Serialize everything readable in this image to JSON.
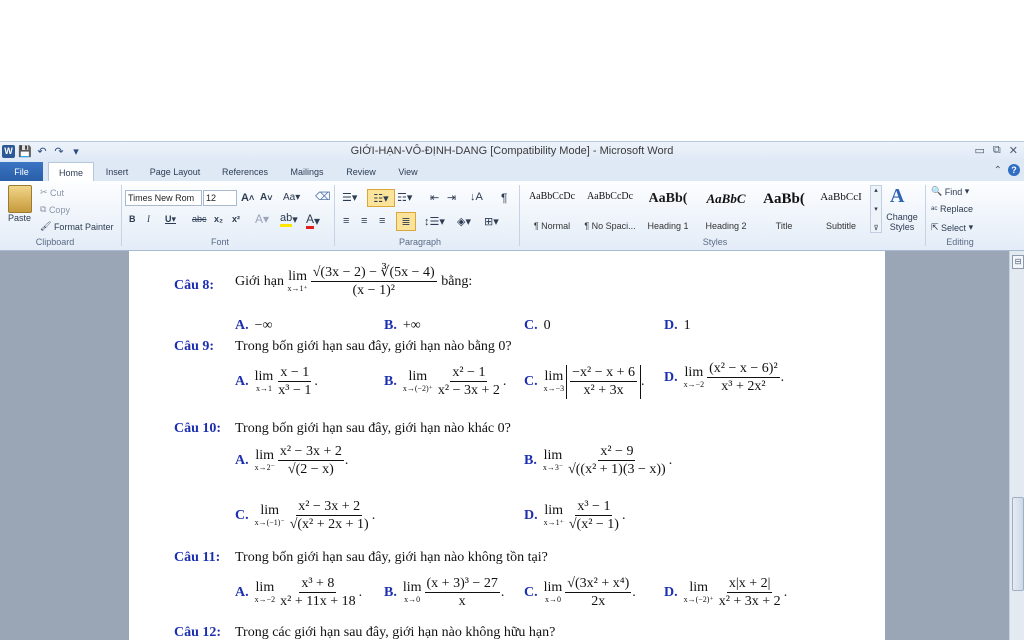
{
  "window": {
    "title": "GIỚI-HẠN-VÔ-ĐỊNH-DANG [Compatibility Mode] - Microsoft Word",
    "app_icon": "W",
    "controls": [
      "▭",
      "⧉",
      "✕"
    ]
  },
  "tabs": [
    "File",
    "Home",
    "Insert",
    "Page Layout",
    "References",
    "Mailings",
    "Review",
    "View"
  ],
  "ribbon": {
    "clipboard": {
      "paste": "Paste",
      "cut": "Cut",
      "copy": "Copy",
      "format_painter": "Format Painter",
      "label": "Clipboard"
    },
    "font": {
      "name": "Times New Rom",
      "size": "12",
      "label": "Font"
    },
    "paragraph": {
      "label": "Paragraph"
    },
    "styles": {
      "items": [
        {
          "sample": "AaBbCcDc",
          "name": "¶ Normal"
        },
        {
          "sample": "AaBbCcDc",
          "name": "¶ No Spaci..."
        },
        {
          "sample": "AaBb(",
          "name": "Heading 1"
        },
        {
          "sample": "AaBbC",
          "name": "Heading 2"
        },
        {
          "sample": "AaBb(",
          "name": "Title"
        },
        {
          "sample": "AaBbCcI",
          "name": "Subtitle"
        }
      ],
      "change_styles": "Change Styles",
      "label": "Styles"
    },
    "editing": {
      "find": "Find",
      "replace": "Replace",
      "select": "Select",
      "label": "Editing"
    }
  },
  "document": {
    "q8": {
      "label": "Câu 8:",
      "text": "Giới hạn",
      "tail": "bằng:",
      "A": "A.",
      "A_val": "−∞",
      "B": "B.",
      "B_val": "+∞",
      "C": "C.",
      "C_val": "0",
      "D": "D.",
      "D_val": "1"
    },
    "q9": {
      "label": "Câu 9:",
      "text": "Trong bốn giới hạn sau đây, giới hạn nào bằng 0?",
      "A": "A.",
      "B": "B.",
      "C": "C.",
      "D": "D."
    },
    "q10": {
      "label": "Câu 10:",
      "text": "Trong bốn giới hạn sau đây, giới hạn nào khác 0?",
      "A": "A.",
      "B": "B.",
      "C": "C.",
      "D": "D."
    },
    "q11": {
      "label": "Câu 11:",
      "text": "Trong bốn giới hạn sau đây, giới hạn nào không tồn tại?",
      "A": "A.",
      "B": "B.",
      "C": "C.",
      "D": "D."
    },
    "q12": {
      "label": "Câu 12:",
      "text": "Trong các giới hạn sau đây, giới hạn nào không hữu hạn?"
    }
  }
}
